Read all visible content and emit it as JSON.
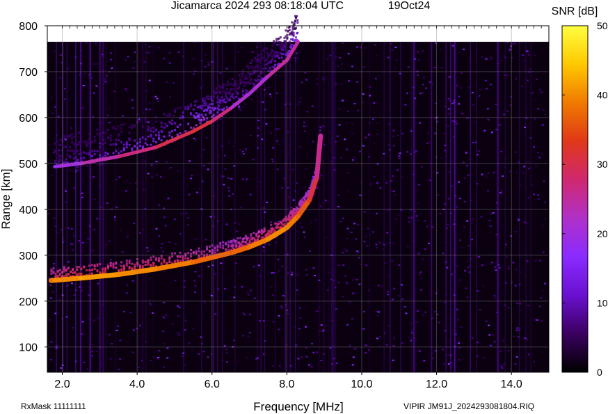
{
  "header": {
    "title": "Jicamarca 2024 293 08:18:04 UTC",
    "date": "19Oct24"
  },
  "colorbar": {
    "label": "SNR [dB]",
    "ticks": [
      0,
      10,
      20,
      30,
      40,
      50
    ],
    "tick_labels": [
      "0",
      "10",
      "20",
      "30",
      "40",
      "50"
    ],
    "stops": [
      "#000000",
      "#3a0060",
      "#6a10d0",
      "#8a2bff",
      "#b030c8",
      "#d02870",
      "#e03818",
      "#f07a00",
      "#ffc800",
      "#ffff40"
    ]
  },
  "footer": {
    "left": "RxMask 11111111",
    "right": "VIPIR  JM91J_2024293081804.RIQ"
  },
  "chart_data": {
    "type": "heatmap",
    "title": "Jicamarca 2024 293 08:18:04 UTC",
    "xlabel": "Frequency [MHz]",
    "ylabel": "Range [km]",
    "xlim": [
      1.6,
      15.0
    ],
    "ylim": [
      45,
      800
    ],
    "data_ymax": 765,
    "xticks": [
      2.0,
      4.0,
      6.0,
      8.0,
      10.0,
      12.0,
      14.0
    ],
    "xtick_labels": [
      "2.0",
      "4.0",
      "6.0",
      "8.0",
      "10.0",
      "12.0",
      "14.0"
    ],
    "yticks": [
      100,
      200,
      300,
      400,
      500,
      600,
      700,
      800
    ],
    "ytick_labels": [
      "100",
      "200",
      "300",
      "400",
      "500",
      "600",
      "700",
      "800"
    ],
    "colorbar_range": [
      0,
      50
    ],
    "grid": true,
    "series": [
      {
        "name": "",
        "trace": "lower",
        "x": [
          1.7,
          2.5,
          3.5,
          4.5,
          5.5,
          6.5,
          7.0,
          7.5,
          8.0,
          8.3,
          8.6,
          8.8,
          8.9
        ],
        "y": [
          245,
          250,
          258,
          270,
          285,
          305,
          318,
          335,
          360,
          385,
          420,
          470,
          560
        ],
        "snr": [
          38,
          42,
          40,
          40,
          38,
          36,
          38,
          40,
          40,
          38,
          34,
          28,
          24
        ]
      },
      {
        "name": "",
        "trace": "upper",
        "x": [
          1.8,
          2.5,
          3.5,
          4.5,
          5.5,
          6.0,
          6.5,
          7.0,
          7.5,
          8.0,
          8.3
        ],
        "y": [
          493,
          500,
          515,
          535,
          570,
          592,
          620,
          652,
          690,
          725,
          765
        ],
        "snr": [
          18,
          22,
          26,
          28,
          32,
          30,
          24,
          20,
          24,
          26,
          24
        ]
      }
    ]
  }
}
